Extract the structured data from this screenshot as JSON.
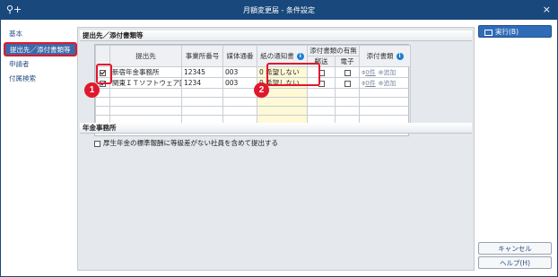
{
  "window": {
    "title": "月額変更届 - 条件設定",
    "app_icon": "search-plus-icon",
    "close_label": "×"
  },
  "sidebar": {
    "items": [
      {
        "label": "基本",
        "selected": false
      },
      {
        "label": "提出先／添付書類等",
        "selected": true
      },
      {
        "label": "申請者",
        "selected": false
      },
      {
        "label": "付属検索",
        "selected": false
      }
    ]
  },
  "section1": {
    "title": "提出先／添付書類等",
    "headers": {
      "submit_to": "提出先",
      "office_no": "事業所番号",
      "media_no": "媒体通番",
      "paper_notice": "紙の通知書",
      "attach_presence": "添付書類の有無",
      "mail": "郵送",
      "electronic": "電子",
      "attach_docs": "添付書類"
    },
    "rows": [
      {
        "checked": true,
        "name": "新宿年金事務所",
        "office_no": "12345",
        "media_no": "003",
        "paper_count": "0",
        "paper_value": "希望しない",
        "attach_count": "0件",
        "add_label": "追加"
      },
      {
        "checked": true,
        "name": "関東ＩＴソフトウェア[",
        "office_no": "1234",
        "media_no": "003",
        "paper_count": "0",
        "paper_value": "希望しない",
        "attach_count": "0件",
        "add_label": "追加"
      }
    ]
  },
  "section2": {
    "title": "年金事務所",
    "checkbox_label": "厚生年金の標準報酬に等級差がない社員を含めて提出する",
    "checked": false
  },
  "buttons": {
    "execute": "実行(B)",
    "cancel": "キャンセル",
    "help": "ヘルプ(H)"
  },
  "badges": {
    "one": "1",
    "two": "2"
  },
  "colors": {
    "titlebar": "#19487c",
    "accent": "#2f6cb8",
    "highlight": "#e0182d",
    "paper_cell": "#fff9d6"
  }
}
